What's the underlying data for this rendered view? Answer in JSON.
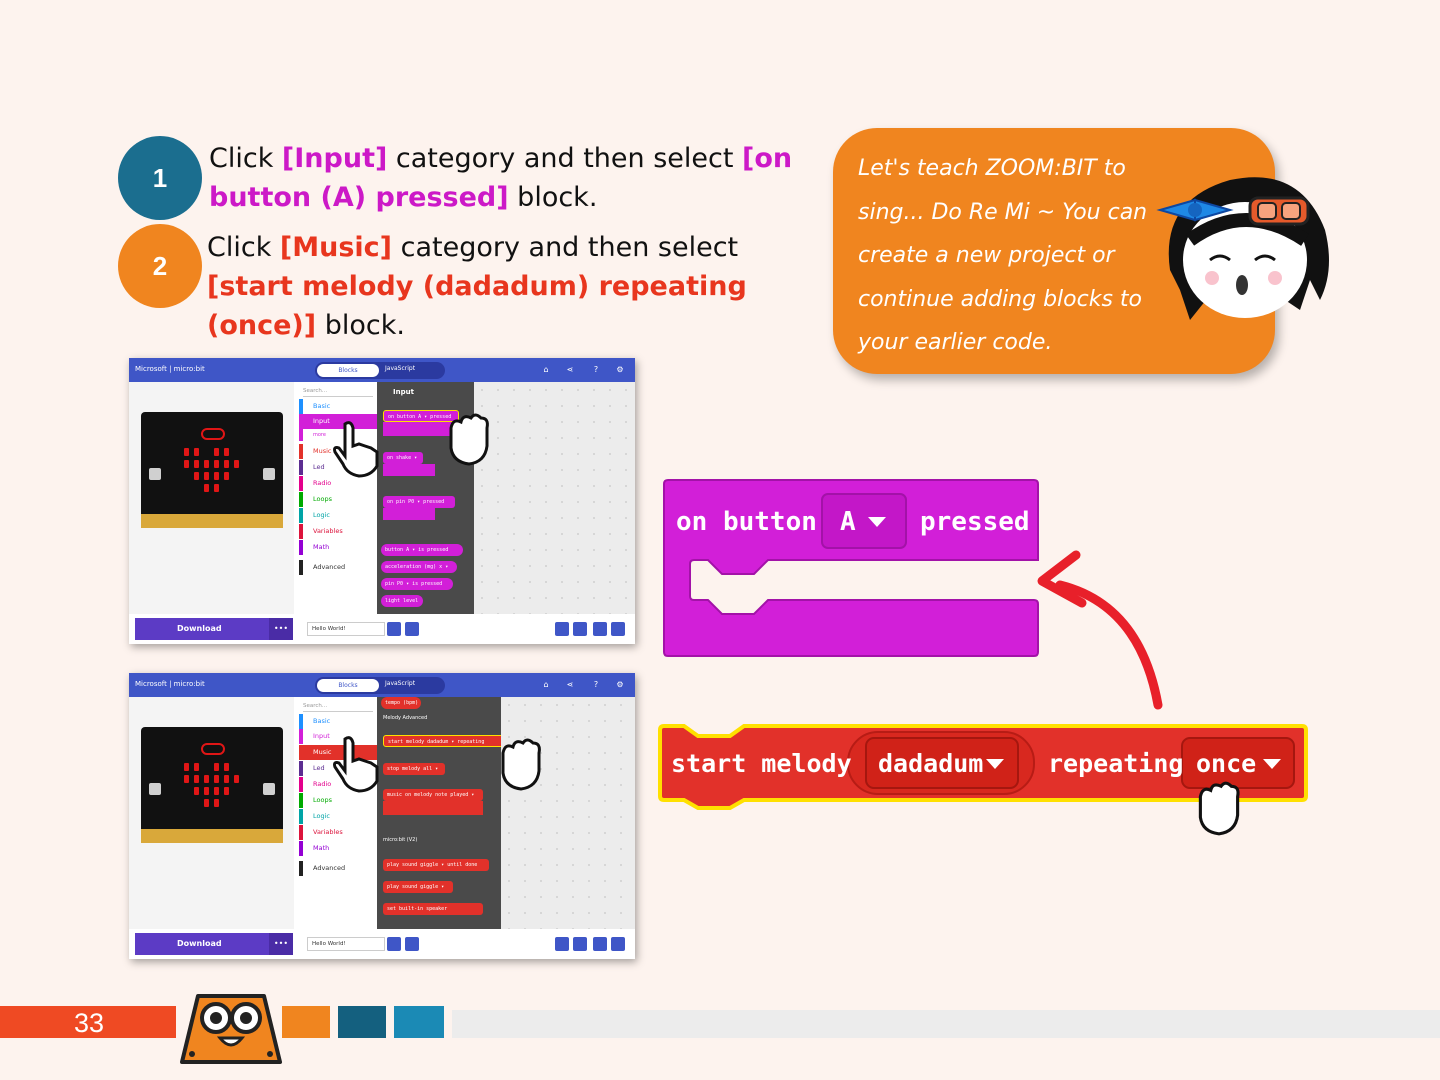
{
  "steps": [
    {
      "number": "1",
      "color": "#1b6e8f",
      "parts": [
        {
          "text": "Click ",
          "style": "plain"
        },
        {
          "text": "[Input]",
          "style": "magenta"
        },
        {
          "text": " category and then select ",
          "style": "plain"
        },
        {
          "text": "[on button (A) pressed]",
          "style": "magenta"
        },
        {
          "text": " block.",
          "style": "plain"
        }
      ]
    },
    {
      "number": "2",
      "color": "#f0851f",
      "parts": [
        {
          "text": "Click ",
          "style": "plain"
        },
        {
          "text": "[Music]",
          "style": "red"
        },
        {
          "text": " category and then select ",
          "style": "plain"
        },
        {
          "text": "[start melody (dadadum) repeating (once)]",
          "style": "red"
        },
        {
          "text": " block.",
          "style": "plain"
        }
      ]
    }
  ],
  "bubble": {
    "text": "Let's teach ZOOM:BIT to sing... Do Re Mi ~ You can create a new project or continue adding blocks to your earlier code."
  },
  "screenshots": [
    {
      "brand": "Microsoft | micro:bit",
      "tab_blocks": "Blocks",
      "tab_js": "JavaScript",
      "search_placeholder": "Search...",
      "categories": [
        "Basic",
        "Input",
        "more",
        "Music",
        "Led",
        "Radio",
        "Loops",
        "Logic",
        "Variables",
        "Math",
        "Advanced"
      ],
      "selected": "Input",
      "palette_title": "Input",
      "palette_blocks": [
        "on button A ▾ pressed",
        "on shake ▾",
        "on pin P0 ▾ pressed",
        "button A ▾ is pressed",
        "acceleration (mg) x ▾",
        "pin P0 ▾ is pressed",
        "light level"
      ],
      "download": "Download",
      "project_name": "Hello World!"
    },
    {
      "brand": "Microsoft | micro:bit",
      "tab_blocks": "Blocks",
      "tab_js": "JavaScript",
      "search_placeholder": "Search...",
      "categories": [
        "Basic",
        "Input",
        "Music",
        "Led",
        "Radio",
        "Loops",
        "Logic",
        "Variables",
        "Math",
        "Advanced"
      ],
      "selected": "Music",
      "palette_title": "",
      "palette_blocks": [
        "tempo (bpm)",
        "Melody Advanced",
        "start melody dadadum ▾ repeating",
        "stop melody all ▾",
        "music on melody note played ▾",
        "micro:bit (V2)",
        "play sound giggle ▾ until done",
        "play sound giggle ▾",
        "set built-in speaker"
      ],
      "download": "Download",
      "project_name": "Hello World!"
    }
  ],
  "block_input": {
    "prefix": "on button",
    "dropdown": "A",
    "suffix": "pressed"
  },
  "block_music": {
    "prefix": "start melody",
    "melody": "dadadum",
    "middle": "repeating",
    "repeat": "once"
  },
  "footer": {
    "page_number": "33"
  },
  "colors": {
    "input": "#d21fd8",
    "music": "#e2312a",
    "orange": "#f0851f",
    "teal_dark": "#1b6e8f",
    "teal": "#1b8ab5",
    "footer_red": "#ef4a23"
  }
}
